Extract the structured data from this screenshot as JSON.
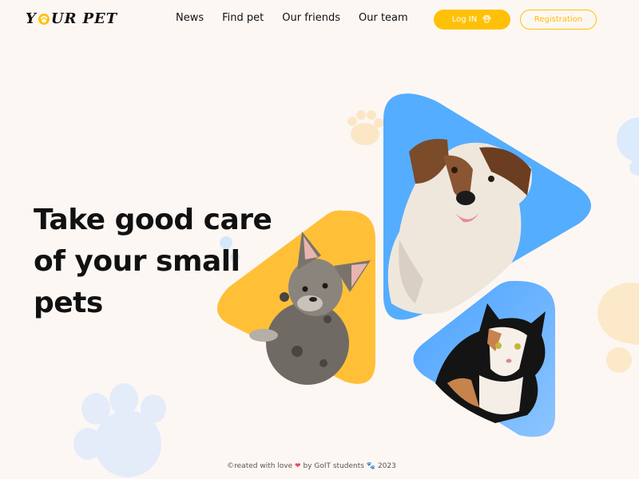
{
  "header": {
    "logo": {
      "part1": "Y",
      "part2": "UR",
      "part3": "PET",
      "icon": "paw-icon"
    },
    "nav": [
      "News",
      "Find pet",
      "Our friends",
      "Our team"
    ],
    "login_label": "Log IN",
    "login_icon": "paw-icon",
    "registration_label": "Registration"
  },
  "hero": {
    "title": "Take good care of your small pets"
  },
  "footer": {
    "text_before": "©reated with love",
    "heart_icon": "heart-icon",
    "text_middle": "by GoIT students",
    "paw_icon": "paw-icon",
    "year": "2023"
  },
  "colors": {
    "accent": "#ffc107",
    "blue": "#54adff",
    "background": "#fdf7f4"
  }
}
